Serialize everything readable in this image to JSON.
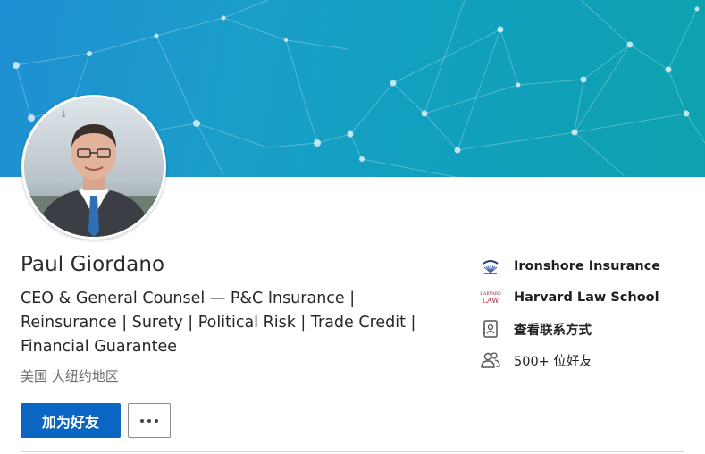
{
  "profile": {
    "name": "Paul Giordano",
    "headline": "CEO & General Counsel — P&C Insurance | Reinsurance | Surety | Political Risk | Trade Credit | Financial Guarantee",
    "location": "美国 大纽约地区"
  },
  "actions": {
    "connect_label": "加为好友",
    "more_label": "..."
  },
  "sidebar": {
    "items": [
      {
        "label": "Ironshore Insurance",
        "icon": "ironshore-logo-icon"
      },
      {
        "label": "Harvard Law School",
        "icon": "harvard-law-logo-icon",
        "logo_text": "HARVARD LAW"
      },
      {
        "label": "查看联系方式",
        "icon": "contact-card-icon"
      },
      {
        "label": "500+ 位好友",
        "icon": "people-icon"
      }
    ]
  },
  "colors": {
    "primary": "#0a66c2",
    "banner_start": "#1f8fd3",
    "banner_end": "#0ea1ad"
  }
}
